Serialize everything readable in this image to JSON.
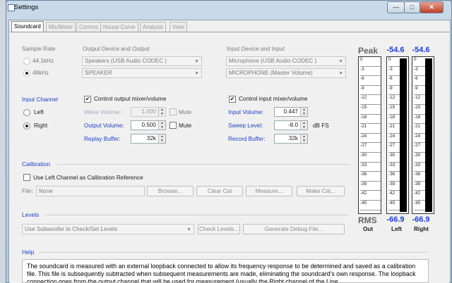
{
  "window": {
    "title": "Settings",
    "buttons": [
      "—",
      "□",
      "✕"
    ]
  },
  "tabs": [
    "Soundcard",
    "Mic/Meter",
    "Comms",
    "House Curve",
    "Analysis",
    "View"
  ],
  "sample_rate": {
    "label": "Sample Rate",
    "options": [
      "44.1kHz",
      "48kHz"
    ],
    "selected": "48kHz"
  },
  "output": {
    "label": "Output Device and Output",
    "device": "Speakers (USB Audio CODEC )",
    "channel": "SPEAKER"
  },
  "input": {
    "label": "Input Device and Input",
    "device": "Microphone (USB Audio CODEC )",
    "channel": "MICROPHONE (Master Volume)"
  },
  "input_channel": {
    "label": "Input Channel",
    "options": [
      "Left",
      "Right"
    ],
    "selected": "Right"
  },
  "output_mixer": {
    "checkbox": "Control output mixer/volume",
    "wave_volume_label": "Wave Volume:",
    "wave_volume": "1.000",
    "output_volume_label": "Output Volume:",
    "output_volume": "0.500",
    "replay_buffer_label": "Replay Buffer:",
    "replay_buffer": "32k",
    "mute": "Mute"
  },
  "input_mixer": {
    "checkbox": "Control input mixer/volume",
    "input_volume_label": "Input Volume:",
    "input_volume": "0.447",
    "sweep_level_label": "Sweep Level:",
    "sweep_level": "-8.0",
    "sweep_unit": "dB FS",
    "record_buffer_label": "Record Buffer:",
    "record_buffer": "32k"
  },
  "calibration": {
    "title": "Calibration",
    "checkbox": "Use Left Channel as Calibration Reference",
    "file_label": "File:",
    "file_value": "None",
    "browse": "Browse...",
    "clear": "Clear Cal",
    "measure": "Measure...",
    "make": "Make Cal..."
  },
  "levels": {
    "title": "Levels",
    "combo": "Use Subwoofer to Check/Set Levels",
    "check": "Check Levels...",
    "debug": "Generate Debug File..."
  },
  "help": {
    "title": "Help",
    "text": "The soundcard is measured with an external loopback connected to allow its frequency response to be determined and saved as a calibration file. This file is subsequently subtracted when subsequent measurements are made, eliminating the soundcard's own response. The loopback connection goes from the output channel that will be used for measurement (usually the Right channel of the Line"
  },
  "meters": {
    "peak_label": "Peak",
    "rms_label": "RMS",
    "out_label": "Out",
    "left_label": "Left",
    "right_label": "Right",
    "peak_left": "-54.6",
    "peak_right": "-54.6",
    "rms_left": "-66.9",
    "rms_right": "-66.9",
    "scale": [
      "0",
      "-3",
      "-6",
      "-9",
      "-12",
      "-15",
      "-18",
      "-21",
      "-24",
      "-27",
      "-30",
      "-33",
      "-36",
      "-39",
      "-42",
      "-45"
    ],
    "colors": {
      "value": "#1d3fc4",
      "bar": "#000000"
    }
  }
}
